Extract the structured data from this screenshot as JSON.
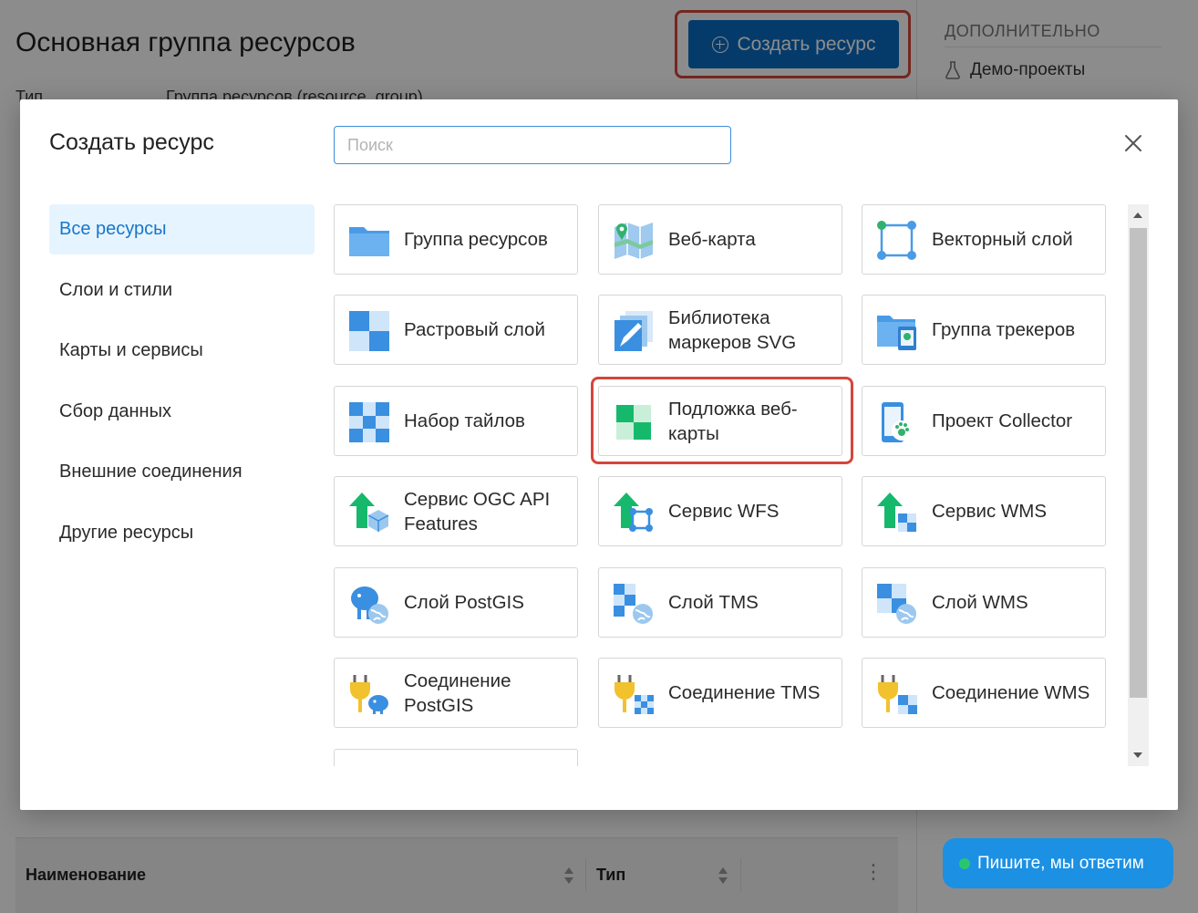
{
  "page": {
    "title": "Основная группа ресурсов",
    "create_button": "Создать ресурс",
    "meta_label": "Тип",
    "meta_value": "Группа ресурсов (resource_group)",
    "aside_title": "ДОПОЛНИТЕЛЬНО",
    "aside_item": "Демо-проекты",
    "table_col_name": "Наименование",
    "table_col_type": "Тип"
  },
  "chat": {
    "label": "Пишите, мы ответим"
  },
  "modal": {
    "title": "Создать ресурс",
    "search_placeholder": "Поиск",
    "categories": [
      "Все ресурсы",
      "Слои и стили",
      "Карты и сервисы",
      "Сбор данных",
      "Внешние соединения",
      "Другие ресурсы"
    ],
    "active_category": "Все ресурсы",
    "cards": [
      {
        "label": "Группа ресурсов",
        "icon": "folder-icon"
      },
      {
        "label": "Веб-карта",
        "icon": "webmap-icon"
      },
      {
        "label": "Векторный слой",
        "icon": "vector-layer-icon"
      },
      {
        "label": "Растровый слой",
        "icon": "raster-layer-icon"
      },
      {
        "label": "Библиотека маркеров SVG",
        "icon": "svg-marker-library-icon"
      },
      {
        "label": "Группа трекеров",
        "icon": "tracker-group-icon"
      },
      {
        "label": "Набор тайлов",
        "icon": "tileset-icon"
      },
      {
        "label": "Подложка веб-карты",
        "icon": "basemap-icon"
      },
      {
        "label": "Проект Collector",
        "icon": "collector-project-icon"
      },
      {
        "label": "Сервис OGC API Features",
        "icon": "ogcapi-service-icon"
      },
      {
        "label": "Сервис WFS",
        "icon": "wfs-service-icon"
      },
      {
        "label": "Сервис WMS",
        "icon": "wms-service-icon"
      },
      {
        "label": "Слой PostGIS",
        "icon": "postgis-layer-icon"
      },
      {
        "label": "Слой TMS",
        "icon": "tms-layer-icon"
      },
      {
        "label": "Слой WMS",
        "icon": "wms-layer-icon"
      },
      {
        "label": "Соединение PostGIS",
        "icon": "postgis-connection-icon"
      },
      {
        "label": "Соединение TMS",
        "icon": "tms-connection-icon"
      },
      {
        "label": "Соединение WMS",
        "icon": "wms-connection-icon"
      }
    ],
    "highlighted_card": "Подложка веб-карты"
  },
  "colors": {
    "primary": "#0a6cc4",
    "highlight": "#d4473b",
    "active_bg": "#e6f4ff",
    "chat": "#1c90e3",
    "chat_dot": "#28c76f"
  }
}
